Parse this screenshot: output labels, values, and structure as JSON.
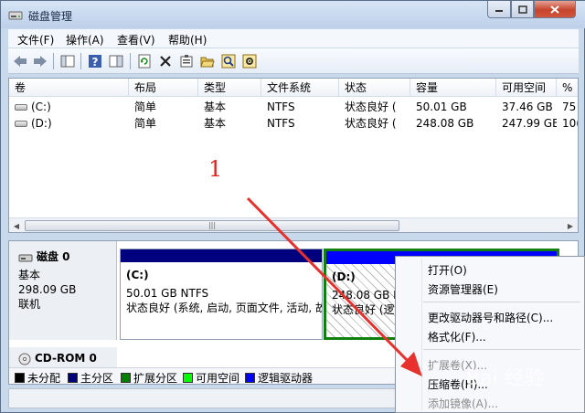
{
  "window": {
    "title": "磁盘管理"
  },
  "menubar": {
    "items": [
      "文件(F)",
      "操作(A)",
      "查看(V)",
      "帮助(H)"
    ]
  },
  "volume_list": {
    "columns": [
      "卷",
      "布局",
      "类型",
      "文件系统",
      "状态",
      "容量",
      "可用空间",
      "%"
    ],
    "rows": [
      [
        "(C:)",
        "简单",
        "基本",
        "NTFS",
        "状态良好 (",
        "50.01 GB",
        "37.46 GB",
        "75"
      ],
      [
        "(D:)",
        "简单",
        "基本",
        "NTFS",
        "状态良好 (",
        "248.08 GB",
        "247.99 GB",
        "10("
      ]
    ]
  },
  "annotation": {
    "number": "1"
  },
  "disk0": {
    "name": "磁盘 0",
    "type": "基本",
    "size": "298.09 GB",
    "status": "联机"
  },
  "partitions": {
    "c": {
      "name": "(C:)",
      "size": "50.01 GB NTFS",
      "status": "状态良好 (系统, 启动, 页面文件, 活动, 故"
    },
    "d": {
      "name": "(D:)",
      "size": "248.08 GB N",
      "status": "状态良好 (逻"
    }
  },
  "cdrom": {
    "name": "CD-ROM 0"
  },
  "legend": [
    {
      "label": "未分配",
      "color": "#000000"
    },
    {
      "label": "主分区",
      "color": "#00007f"
    },
    {
      "label": "扩展分区",
      "color": "#008000"
    },
    {
      "label": "可用空间",
      "color": "#00ff00"
    },
    {
      "label": "逻辑驱动器",
      "color": "#0000ff"
    }
  ],
  "context_menu": {
    "open": "打开(O)",
    "explorer": "资源管理器(E)",
    "change_letter": "更改驱动器号和路径(C)...",
    "format": "格式化(F)...",
    "extend": "扩展卷(X)...",
    "shrink": "压缩卷(H)...",
    "add_mirror": "添加镜像(A)..."
  },
  "watermark": "Bai 经验",
  "colors": {
    "arrow": "#e8312c",
    "primary_partition": "#00007f",
    "logical_drive": "#0000ff",
    "selection_border": "#11800f"
  }
}
